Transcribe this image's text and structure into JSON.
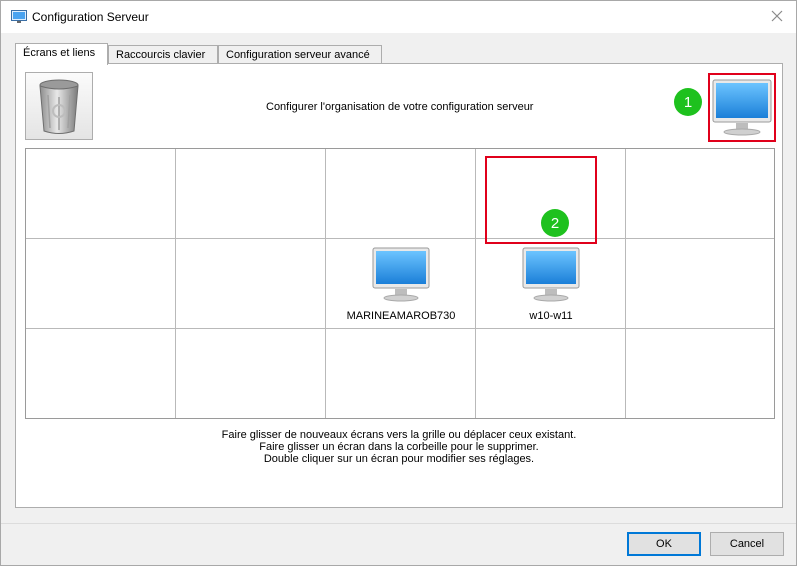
{
  "window": {
    "title": "Configuration Serveur"
  },
  "tabs": [
    {
      "label": "Écrans et liens",
      "active": true
    },
    {
      "label": "Raccourcis clavier",
      "active": false
    },
    {
      "label": "Configuration serveur avancé",
      "active": false
    }
  ],
  "panel": {
    "header_text": "Configurer l'organisation de votre configuration serveur",
    "grid": {
      "rows": 3,
      "cols": 5
    },
    "screens": [
      {
        "name": "MARINEAMAROB730",
        "row": 2,
        "col": 3
      },
      {
        "name": "w10-w11",
        "row": 2,
        "col": 4
      }
    ],
    "badges": [
      "1",
      "2"
    ],
    "hints": [
      "Faire glisser de nouveaux écrans vers la grille ou déplacer ceux existant.",
      "Faire glisser un écran dans la corbeille pour le supprimer.",
      "Double cliquer sur un écran pour modifier ses réglages."
    ]
  },
  "buttons": {
    "ok": "OK",
    "cancel": "Cancel"
  },
  "icons": [
    "app-icon",
    "close-icon",
    "trash-icon",
    "monitor-icon"
  ],
  "colors": {
    "highlight": "#e0001b",
    "badge": "#1ec11e"
  }
}
